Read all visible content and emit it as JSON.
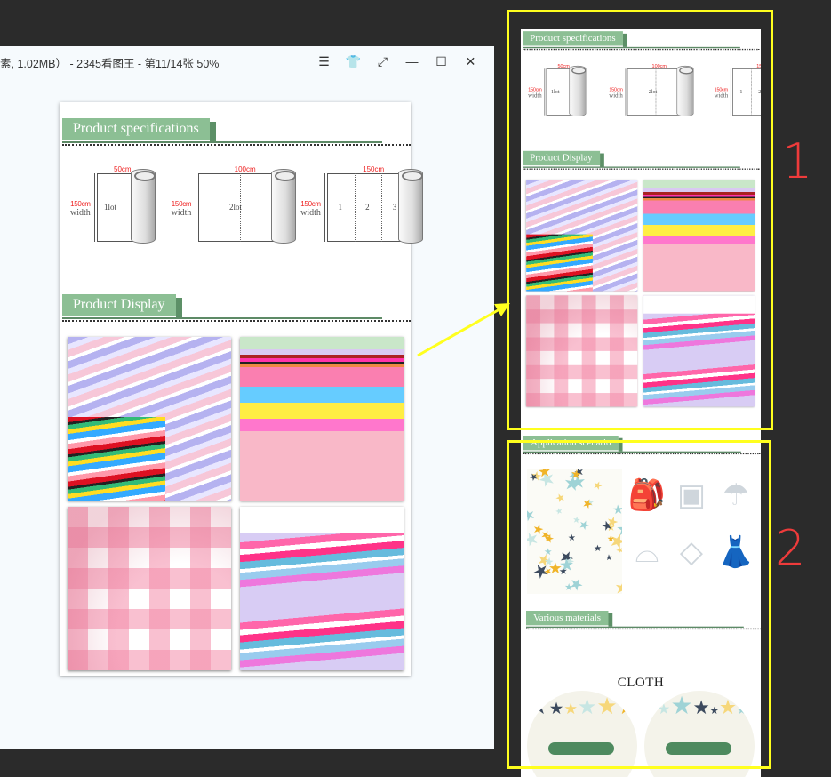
{
  "viewer": {
    "title": "素, 1.02MB） - 2345看图王 - 第11/14张 50%",
    "buttons": [
      {
        "name": "menu-icon",
        "glyph": "☰"
      },
      {
        "name": "skin-icon",
        "glyph": "👕"
      },
      {
        "name": "fullscreen-icon",
        "glyph": "⤢"
      },
      {
        "name": "minimize-icon",
        "glyph": "—"
      },
      {
        "name": "maximize-icon",
        "glyph": "☐"
      },
      {
        "name": "close-icon",
        "glyph": "✕"
      }
    ]
  },
  "doc": {
    "spec_title": "Product specifications",
    "display_title": "Product Display",
    "specs": [
      {
        "top": "50cm",
        "width_cm": "150cm",
        "width": "width",
        "labels": [
          "1lot"
        ]
      },
      {
        "top": "100cm",
        "width_cm": "150cm",
        "width": "width",
        "labels": [
          "2lot"
        ]
      },
      {
        "top": "150cm",
        "width_cm": "150cm",
        "width": "width",
        "labels": [
          "1",
          "2",
          "3"
        ]
      }
    ]
  },
  "right": {
    "application_title": "Application scenario",
    "materials_title": "Various materials",
    "cloth": "CLOTH"
  },
  "annotations": {
    "one": "1",
    "two": "2"
  },
  "colors": {
    "accent": "#8cbf94",
    "highlight": "#ffff1e",
    "annotation": "#ee3b3b"
  }
}
